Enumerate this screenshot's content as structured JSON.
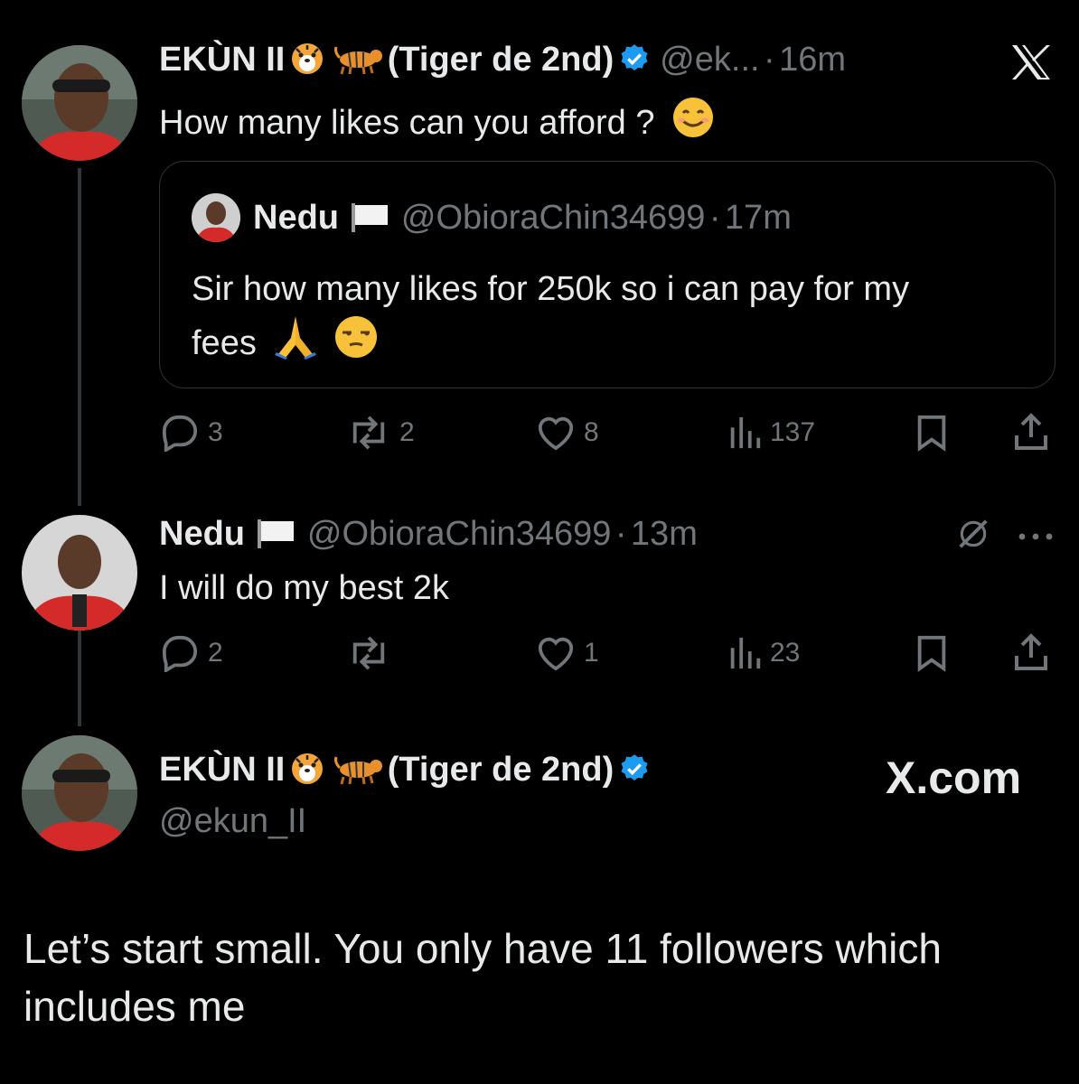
{
  "tweet1": {
    "name": "EKÙN II",
    "name_suffix": "(Tiger de 2nd)",
    "handle": "@ek...",
    "dot": "·",
    "time": "16m",
    "text": "How many likes can you afford ?",
    "quote": {
      "name": "Nedu",
      "handle": "@ObioraChin34699",
      "dot": "·",
      "time": "17m",
      "text_line1": "Sir how many likes for 250k so i can pay for my",
      "text_line2": "fees"
    },
    "stats": {
      "replies": "3",
      "reposts": "2",
      "likes": "8",
      "views": "137"
    }
  },
  "tweet2": {
    "name": "Nedu",
    "handle": "@ObioraChin34699",
    "dot": "·",
    "time": "13m",
    "text": "I will do my best 2k",
    "stats": {
      "replies": "2",
      "reposts": "",
      "likes": "1",
      "views": "23"
    }
  },
  "tweet3": {
    "name": "EKÙN II",
    "name_suffix": "(Tiger de 2nd)",
    "handle": "@ekun_II",
    "watermark": "X.com",
    "text_line1": "Let’s start small. You only have 11 followers which",
    "text_line2": "includes me"
  },
  "icons": {
    "logo": "x-logo-icon",
    "verified": "verified-badge-icon",
    "reply": "reply-icon",
    "repost": "repost-icon",
    "like": "heart-icon",
    "views": "views-icon",
    "bookmark": "bookmark-icon",
    "share": "share-icon",
    "grok": "grok-icon",
    "more": "more-icon"
  },
  "colors": {
    "background": "#000000",
    "text": "#e7e9ea",
    "muted": "#71767b",
    "verified": "#1d9bf0"
  }
}
